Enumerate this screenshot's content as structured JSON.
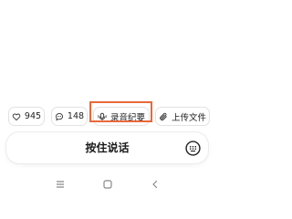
{
  "actions": {
    "like": {
      "icon": "heart-icon",
      "count": "945"
    },
    "comment": {
      "icon": "comment-icon",
      "count": "148"
    },
    "record": {
      "icon": "microphone-icon",
      "label": "录音纪要"
    },
    "upload": {
      "icon": "paperclip-icon",
      "label": "上传文件"
    }
  },
  "input_bar": {
    "label": "按住说话",
    "keyboard_icon": "keyboard-icon"
  },
  "nav_bar": {
    "menu_icon": "menu-icon",
    "home_icon": "home-icon",
    "back_icon": "back-icon"
  },
  "colors": {
    "highlight": "#e8693a",
    "text": "#222222",
    "border": "#e2e2e2"
  }
}
